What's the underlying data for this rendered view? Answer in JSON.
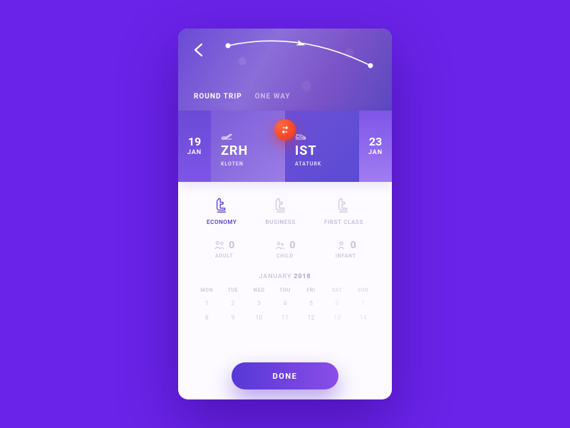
{
  "header": {
    "trip_tabs": {
      "round_trip": "ROUND TRIP",
      "one_way": "ONE WAY",
      "active": "round_trip"
    }
  },
  "route": {
    "depart": {
      "day": "19",
      "month": "JAN"
    },
    "return": {
      "day": "23",
      "month": "JAN"
    },
    "origin": {
      "code": "ZRH",
      "name": "KLOTEN"
    },
    "destination": {
      "code": "IST",
      "name": "ATATURK"
    }
  },
  "cabin": {
    "economy": "ECONOMY",
    "business": "BUSINESS",
    "first": "FIRST CLASS",
    "active": "economy"
  },
  "passengers": {
    "adult": {
      "label": "ADULT",
      "count": "0"
    },
    "child": {
      "label": "CHILD",
      "count": "0"
    },
    "infant": {
      "label": "INFANT",
      "count": "0"
    }
  },
  "calendar": {
    "month": "JANUARY",
    "year": "2018",
    "dow": [
      "MON",
      "TUE",
      "WED",
      "THU",
      "FRI",
      "SAT",
      "SUN"
    ],
    "weeks": [
      [
        "1",
        "2",
        "3",
        "4",
        "5",
        "6",
        "7"
      ],
      [
        "8",
        "9",
        "10",
        "11",
        "12",
        "13",
        "14"
      ]
    ]
  },
  "actions": {
    "done": "DONE"
  },
  "icons": {
    "back": "back-arrow-icon",
    "swap": "swap-icon",
    "plane_depart": "plane-takeoff-icon",
    "plane_arrive": "plane-landing-icon",
    "seat": "seat-icon",
    "adult": "adult-group-icon",
    "child": "child-group-icon",
    "infant": "infant-icon"
  },
  "colors": {
    "brand": "#6a4ad6",
    "accent": "#e8321f",
    "muted": "#c8c0da"
  }
}
